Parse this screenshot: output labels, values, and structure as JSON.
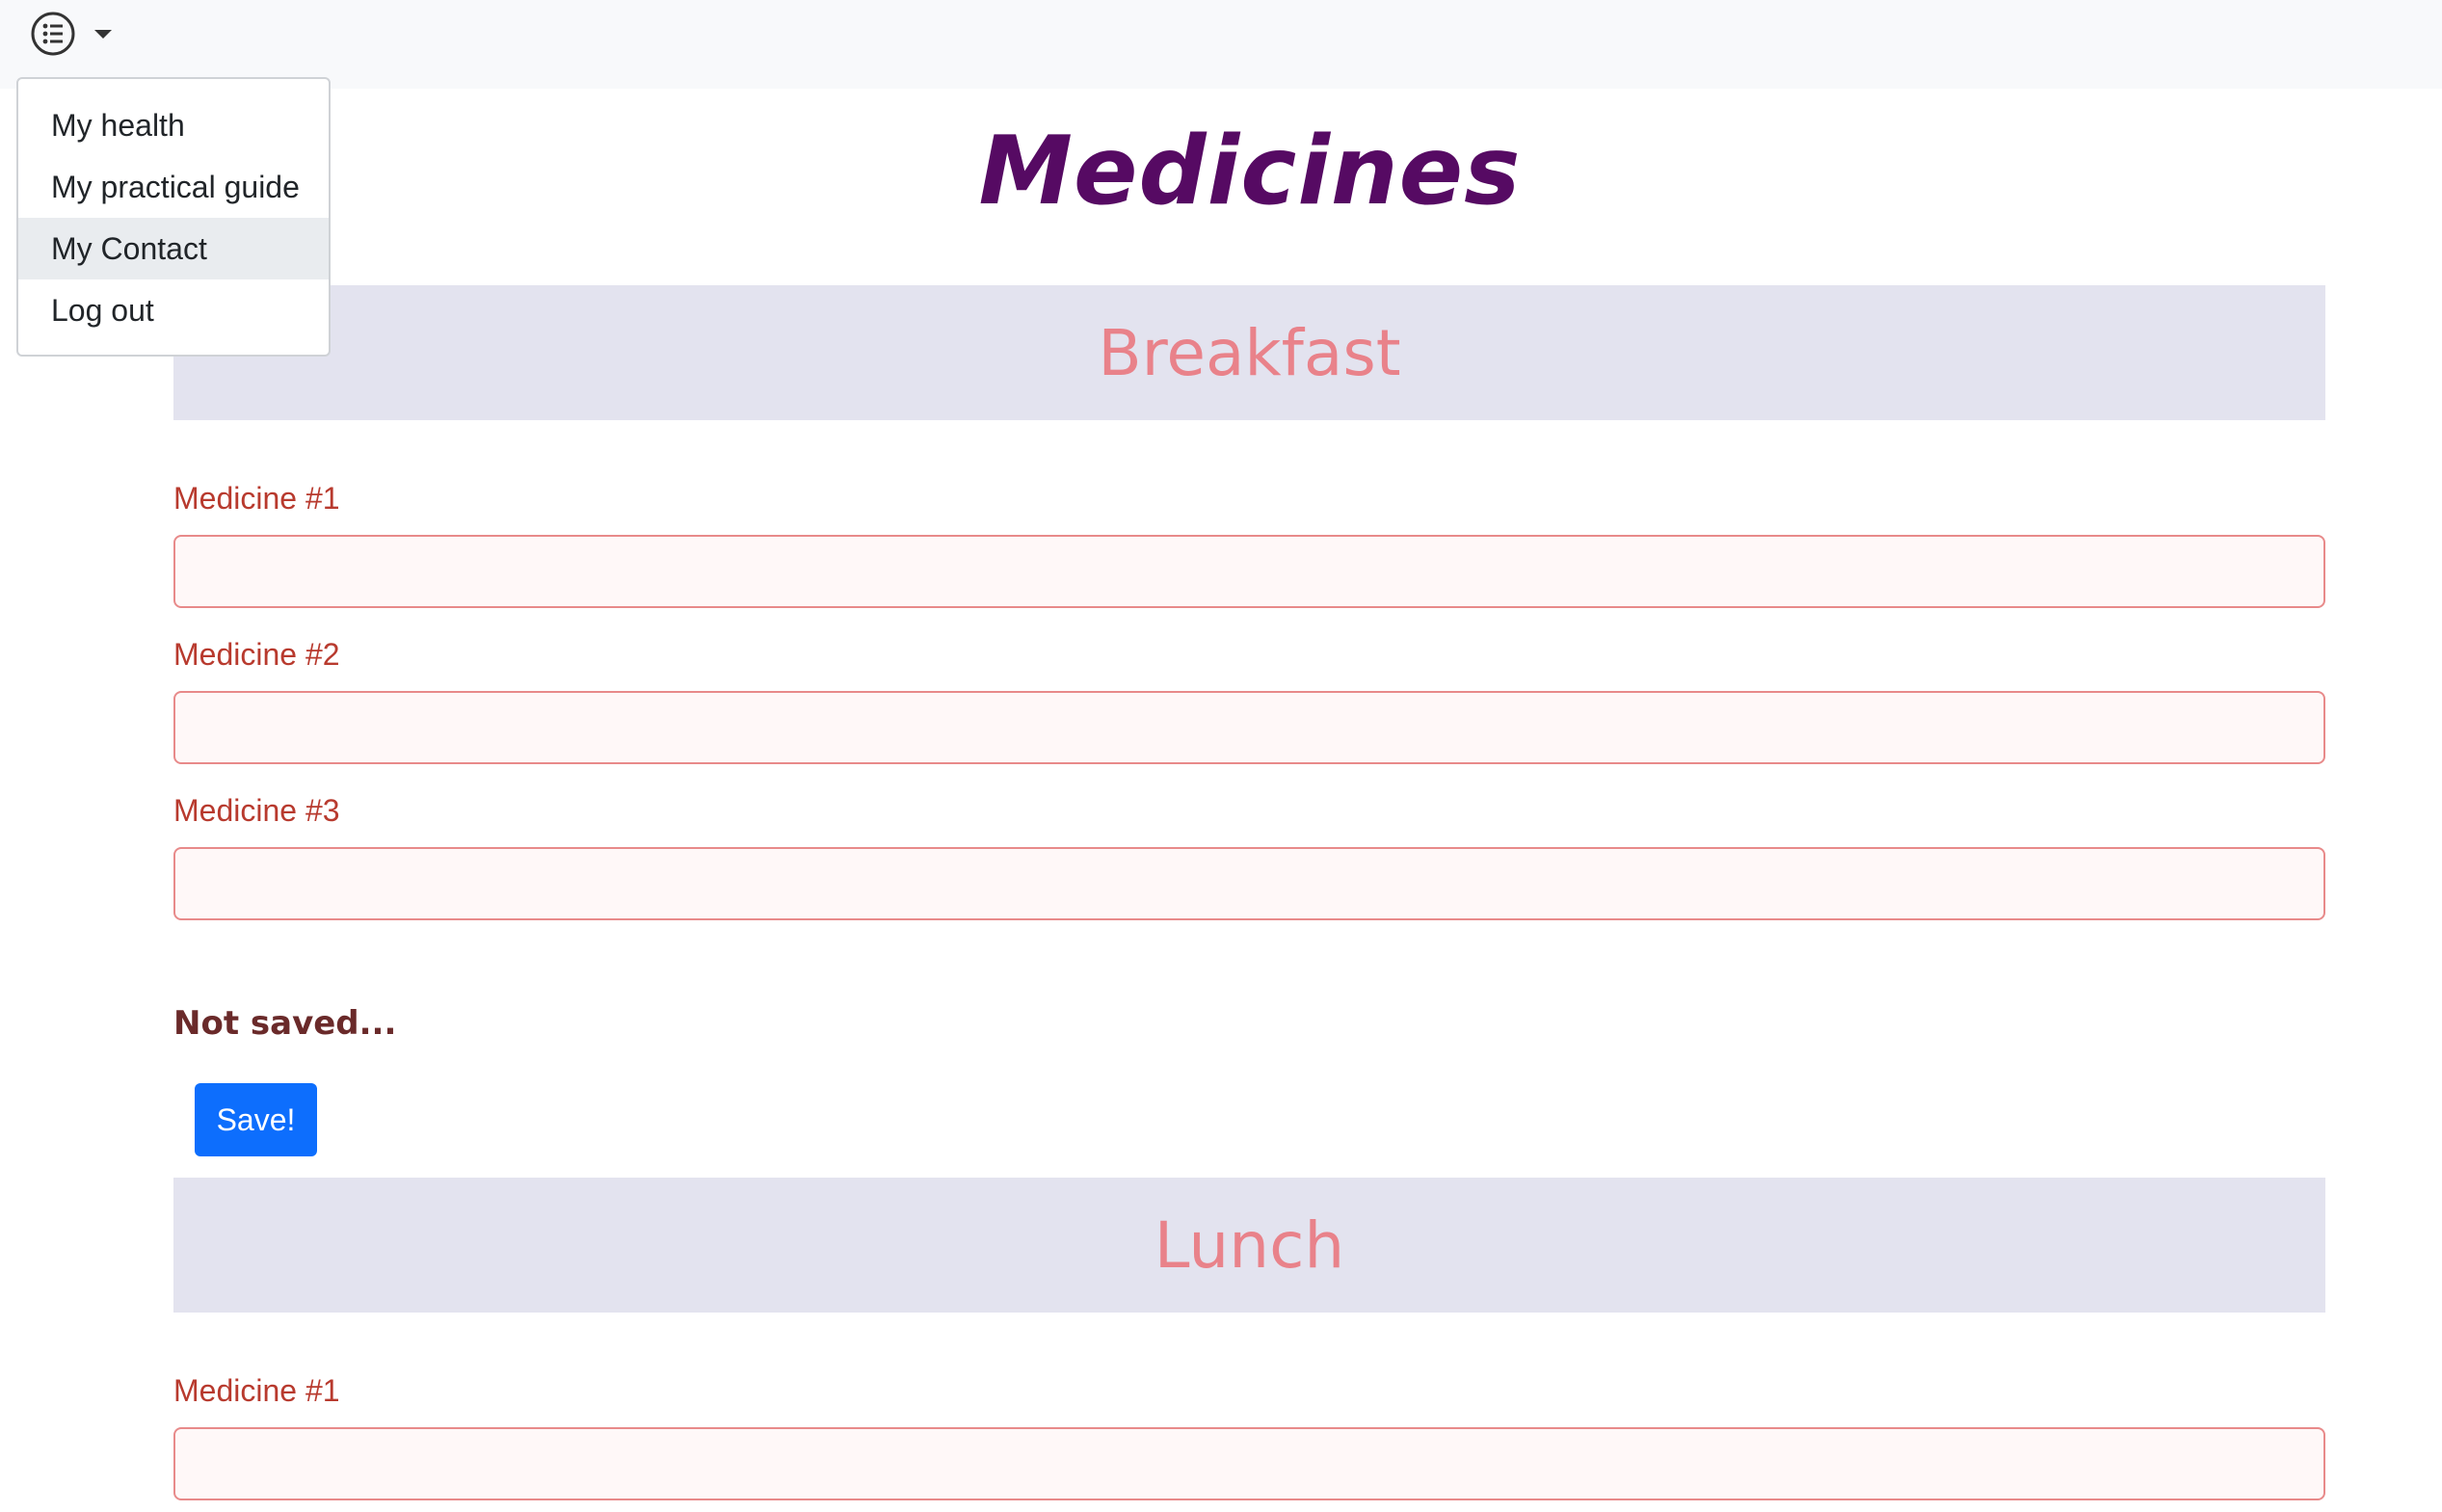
{
  "navbar": {
    "menu_icon": "list-icon",
    "caret_icon": "caret-down-icon"
  },
  "dropdown": {
    "items": [
      {
        "label": "My health"
      },
      {
        "label": "My practical guide"
      },
      {
        "label": "My Contact",
        "active": true
      },
      {
        "label": "Log out"
      }
    ]
  },
  "page": {
    "title": "Medicines"
  },
  "breakfast": {
    "header": "Breakfast",
    "fields": [
      {
        "label": "Medicine #1",
        "value": ""
      },
      {
        "label": "Medicine #2",
        "value": ""
      },
      {
        "label": "Medicine #3",
        "value": ""
      }
    ],
    "status": "Not saved...",
    "save_label": "Save!"
  },
  "lunch": {
    "header": "Lunch",
    "fields": [
      {
        "label": "Medicine #1",
        "value": ""
      }
    ]
  },
  "colors": {
    "title": "#560a63",
    "section_header_bg": "#e3e3ef",
    "section_header_text": "#e9828a",
    "label": "#b83a2e",
    "input_border": "#e88a8a",
    "button": "#0d6efd"
  }
}
